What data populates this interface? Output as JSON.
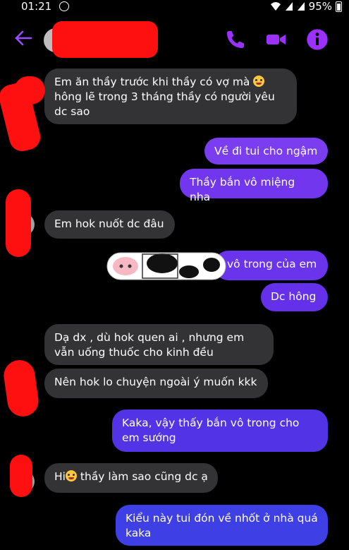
{
  "status": {
    "time": "01:21",
    "battery": "95%"
  },
  "header": {
    "contact_name": ""
  },
  "messages": [
    {
      "dir": "in",
      "text": "Em ăn thầy trước khi thầy có vợ mà",
      "text2": " hông lẽ trong 3 tháng thầy có người yêu dc sao"
    },
    {
      "dir": "out",
      "text": "Về đi tui cho ngậm"
    },
    {
      "dir": "out",
      "text": "Thầy bắn vô miệng nha"
    },
    {
      "dir": "in",
      "text": "Em hok nuốt dc đâu"
    },
    {
      "dir": "out",
      "text": "vô trong của em"
    },
    {
      "dir": "out",
      "text": "Dc hông"
    },
    {
      "dir": "in",
      "text": "Dạ dx , dù hok quen ai , nhưng em vẫn uống thuốc cho kinh đều"
    },
    {
      "dir": "in",
      "text": "Nên hok lo chuyện ngoài ý muốn kkk"
    },
    {
      "dir": "out",
      "text": "Kaka, vậy thấy bắn vô trong cho em sướng"
    },
    {
      "dir": "in",
      "text": "Hi",
      "text2": " thầy làm sao cũng dc ạ"
    },
    {
      "dir": "out",
      "text": "Kiểu này tui đón về nhốt ở nhà quá kaka"
    }
  ],
  "colors": {
    "accent": "#9b30ff",
    "incoming": "#333335",
    "redaction": "#ff1010"
  },
  "icons": [
    "back-arrow-icon",
    "phone-icon",
    "video-icon",
    "info-icon"
  ]
}
